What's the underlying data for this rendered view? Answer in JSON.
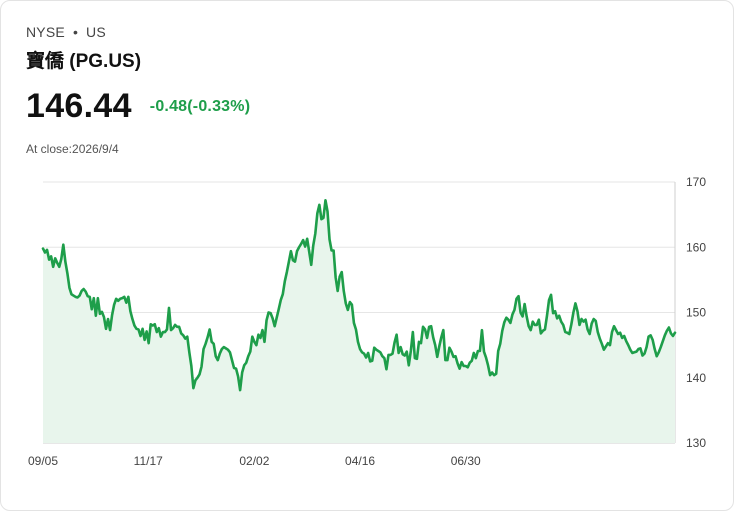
{
  "header": {
    "exchange": "NYSE",
    "separator": "•",
    "region": "US",
    "title": "寶僑 (PG.US)",
    "price": "146.44",
    "change": "-0.48(-0.33%)",
    "close_label": "At close:2026/9/4"
  },
  "colors": {
    "line": "#1e9e4a",
    "fill": "#e8f5ec",
    "grid": "#e6e6e6"
  },
  "chart_data": {
    "type": "area",
    "title": "",
    "xlabel": "",
    "ylabel": "",
    "ylim": [
      130,
      170
    ],
    "yticks": [
      170,
      160,
      150,
      140,
      130
    ],
    "y_axis_side": "right",
    "grid": true,
    "x_tick_labels": [
      "09/05",
      "11/17",
      "02/02",
      "04/16",
      "06/30"
    ],
    "x_tick_index": [
      0,
      52,
      104,
      156,
      208
    ],
    "series": [
      {
        "values": [
          159.8,
          159.2,
          159.6,
          158.1,
          158.6,
          157.0,
          158.3,
          157.6,
          157.0,
          158.2,
          160.4,
          157.8,
          156.0,
          153.8,
          152.8,
          152.6,
          152.4,
          152.3,
          152.6,
          153.3,
          153.6,
          153.2,
          152.5,
          152.4,
          150.5,
          152.2,
          149.5,
          152.2,
          149.8,
          150.1,
          149.3,
          147.5,
          149.0,
          147.3,
          149.6,
          151.2,
          152.1,
          151.8,
          152.1,
          152.2,
          152.4,
          151.5,
          152.4,
          150.2,
          149.0,
          148.0,
          147.5,
          147.4,
          146.4,
          147.5,
          145.8,
          147.1,
          145.3,
          148.2,
          148.0,
          148.2,
          147.0,
          147.6,
          146.3,
          147.0,
          147.0,
          147.4,
          150.7,
          147.3,
          147.6,
          148.1,
          147.8,
          147.8,
          146.8,
          146.5,
          146.0,
          146.3,
          143.9,
          141.8,
          138.4,
          139.6,
          140.0,
          140.5,
          141.7,
          144.4,
          145.2,
          146.2,
          147.4,
          145.5,
          145.2,
          143.3,
          142.7,
          143.7,
          144.4,
          144.7,
          144.5,
          144.3,
          143.9,
          142.7,
          141.5,
          141.4,
          140.2,
          138.1,
          140.8,
          141.9,
          142.3,
          143.3,
          144.0,
          146.3,
          145.5,
          145.0,
          146.6,
          146.1,
          147.3,
          145.5,
          148.8,
          150.0,
          149.9,
          149.1,
          147.9,
          149.2,
          150.5,
          151.9,
          152.8,
          154.8,
          156.2,
          157.8,
          159.4,
          158.0,
          157.8,
          159.4,
          160.0,
          160.5,
          161.1,
          160.1,
          161.3,
          159.3,
          157.3,
          160.3,
          162.1,
          165.2,
          166.5,
          164.3,
          164.5,
          167.2,
          165.5,
          161.2,
          159.5,
          159.5,
          155.4,
          153.3,
          155.5,
          156.2,
          153.3,
          151.4,
          150.4,
          151.6,
          151.2,
          148.4,
          147.4,
          145.5,
          144.4,
          143.9,
          143.7,
          143.1,
          143.8,
          142.5,
          142.6,
          144.6,
          144.3,
          144.1,
          143.9,
          143.3,
          143.0,
          141.3,
          143.5,
          143.5,
          143.7,
          145.4,
          146.6,
          143.8,
          144.7,
          143.6,
          143.4,
          144.0,
          141.9,
          144.1,
          147.0,
          143.0,
          142.9,
          145.5,
          145.3,
          147.8,
          147.4,
          146.1,
          147.8,
          147.9,
          146.2,
          145.0,
          143.2,
          144.8,
          146.2,
          147.3,
          142.7,
          142.7,
          144.6,
          144.0,
          143.2,
          143.3,
          142.2,
          141.4,
          142.4,
          141.8,
          141.8,
          141.6,
          142.3,
          142.6,
          143.8,
          143.0,
          144.1,
          144.1,
          147.3,
          144.0,
          143.1,
          141.9,
          140.4,
          140.8,
          140.4,
          140.6,
          144.1,
          145.2,
          147.2,
          148.5,
          149.2,
          148.9,
          148.4,
          149.7,
          150.4,
          152.1,
          152.5,
          150.0,
          149.4,
          151.3,
          149.4,
          147.9,
          147.3,
          148.6,
          148.1,
          148.1,
          148.9,
          146.8,
          147.2,
          147.4,
          149.5,
          151.9,
          152.7,
          149.9,
          150.2,
          149.1,
          149.5,
          148.6,
          148.1,
          147.0,
          146.9,
          146.7,
          148.2,
          150.0,
          151.4,
          150.2,
          148.1,
          149.0,
          148.6,
          148.9,
          147.4,
          146.7,
          148.3,
          149.0,
          148.7,
          147.0,
          146.0,
          145.2,
          144.3,
          144.8,
          145.3,
          145.0,
          147.0,
          147.9,
          147.3,
          146.7,
          146.9,
          146.1,
          146.4,
          145.6,
          145.0,
          144.3,
          143.8,
          143.9,
          144.0,
          144.4,
          144.5,
          143.4,
          143.7,
          144.7,
          146.3,
          146.5,
          145.8,
          144.4,
          143.3,
          143.9,
          144.7,
          145.6,
          146.5,
          147.2,
          147.7,
          146.8,
          146.4,
          146.9
        ]
      }
    ]
  }
}
